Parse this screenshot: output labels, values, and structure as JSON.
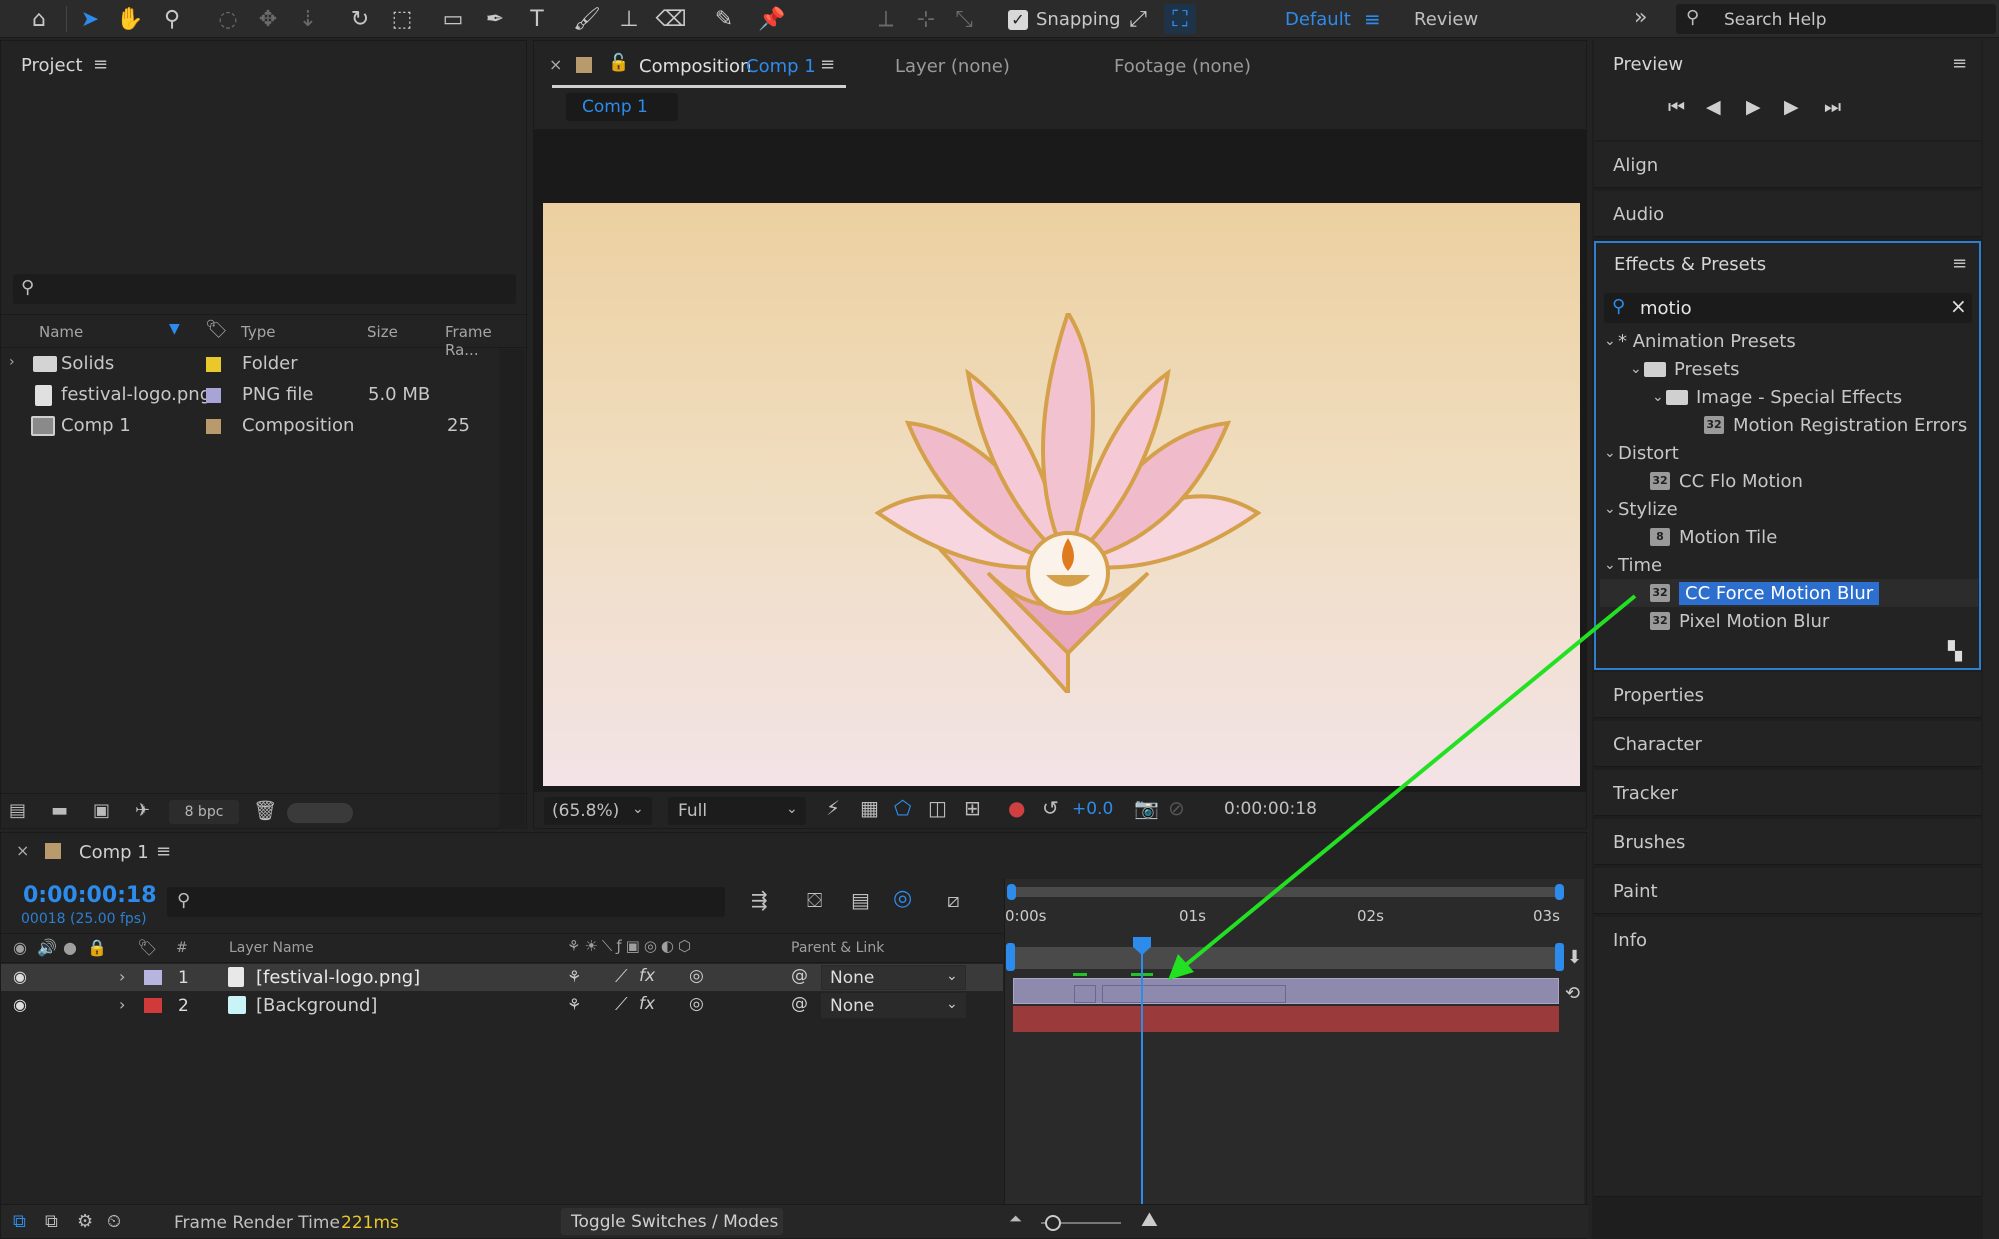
{
  "toolbar": {
    "snapping_label": "Snapping",
    "workspace_default": "Default",
    "workspace_review": "Review",
    "search_placeholder": "Search Help",
    "overflow": "»"
  },
  "project": {
    "title": "Project",
    "columns": [
      "Name",
      "Type",
      "Size",
      "Frame Ra..."
    ],
    "items": [
      {
        "name": "Solids",
        "type": "Folder",
        "size": "",
        "fps": "",
        "color": "#e8c82a"
      },
      {
        "name": "festival-logo.png",
        "type": "PNG file",
        "size": "5.0 MB",
        "fps": "",
        "color": "#a8a4d8"
      },
      {
        "name": "Comp 1",
        "type": "Composition",
        "size": "",
        "fps": "25",
        "color": "#b89a6c"
      }
    ],
    "bpc": "8 bpc"
  },
  "comp_panel": {
    "tab_prefix": "Composition",
    "tab_comp": "Comp 1",
    "layer_tab": "Layer (none)",
    "footage_tab": "Footage (none)",
    "subtab": "Comp 1",
    "zoom": "(65.8%)",
    "resolution": "Full",
    "exposure": "+0.0",
    "timecode": "0:00:00:18"
  },
  "timeline": {
    "comp_name": "Comp 1",
    "timecode": "0:00:00:18",
    "frame_info": "00018 (25.00 fps)",
    "col_num": "#",
    "col_layer": "Layer Name",
    "col_parent": "Parent & Link",
    "ruler": [
      "0:00s",
      "01s",
      "02s",
      "03s"
    ],
    "layers": [
      {
        "num": "1",
        "name": "[festival-logo.png]",
        "parent": "None",
        "label_color": "#b7b4e0"
      },
      {
        "num": "2",
        "name": "[Background]",
        "parent": "None",
        "label_color": "#d03a3a"
      }
    ],
    "render_label": "Frame Render Time",
    "render_value": "221ms",
    "toggle_label": "Toggle Switches / Modes"
  },
  "right": {
    "preview_title": "Preview",
    "align": "Align",
    "audio": "Audio",
    "effects_title": "Effects & Presets",
    "search_value": "motio",
    "tree": [
      {
        "label": "* Animation Presets",
        "level": 0,
        "kind": "group"
      },
      {
        "label": "Presets",
        "level": 1,
        "kind": "folder"
      },
      {
        "label": "Image - Special Effects",
        "level": 2,
        "kind": "folder"
      },
      {
        "label": "Motion Registration Errors",
        "level": 3,
        "kind": "preset"
      },
      {
        "label": "Distort",
        "level": 0,
        "kind": "group"
      },
      {
        "label": "CC Flo Motion",
        "level": 1,
        "kind": "effect"
      },
      {
        "label": "Stylize",
        "level": 0,
        "kind": "group"
      },
      {
        "label": "Motion Tile",
        "level": 1,
        "kind": "effect8"
      },
      {
        "label": "Time",
        "level": 0,
        "kind": "group"
      },
      {
        "label": "CC Force Motion Blur",
        "level": 1,
        "kind": "effect",
        "selected": true
      },
      {
        "label": "Pixel Motion Blur",
        "level": 1,
        "kind": "effect"
      }
    ],
    "panels": [
      "Properties",
      "Character",
      "Tracker",
      "Brushes",
      "Paint",
      "Info"
    ]
  }
}
